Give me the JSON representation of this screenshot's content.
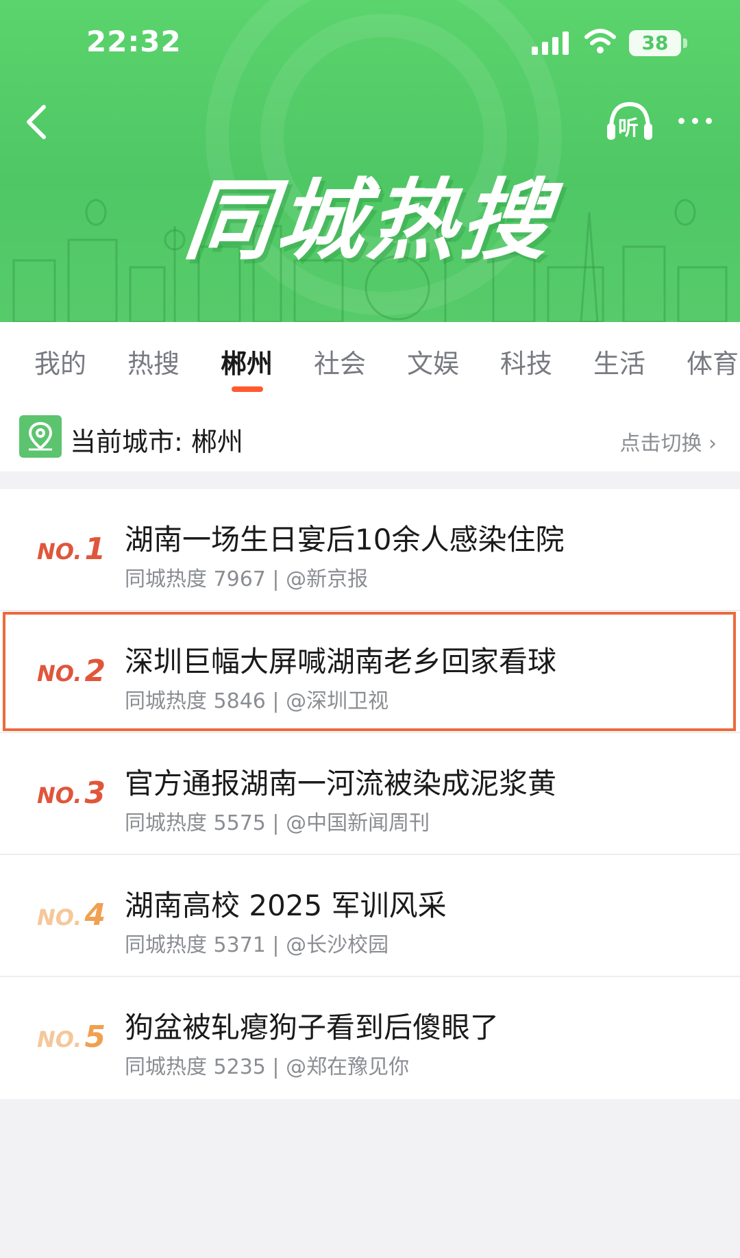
{
  "status_bar": {
    "time": "22:32",
    "battery": "38",
    "signal_icon": "signal-bars-icon",
    "wifi_icon": "wifi-icon"
  },
  "header": {
    "title": "同城热搜",
    "back_icon": "back-arrow-icon",
    "listen_label": "听",
    "more_icon": "more-dots-icon",
    "background_color": "#5bd46d"
  },
  "tabs": [
    {
      "label": "我的"
    },
    {
      "label": "热搜"
    },
    {
      "label": "郴州",
      "active": true
    },
    {
      "label": "社会"
    },
    {
      "label": "文娱"
    },
    {
      "label": "科技"
    },
    {
      "label": "生活"
    },
    {
      "label": "体育"
    }
  ],
  "city_bar": {
    "label": "当前城市: 郴州",
    "switch_label": "点击切换 ›"
  },
  "hot_list": [
    {
      "rank_prefix": "NO.",
      "rank": "1",
      "title": "湖南一场生日宴后10余人感染住院",
      "meta": "同城热度 7967 | @新京报",
      "rank_color": "#e0563a"
    },
    {
      "rank_prefix": "NO.",
      "rank": "2",
      "title": "深圳巨幅大屏喊湖南老乡回家看球",
      "meta": "同城热度 5846 | @深圳卫视",
      "rank_color": "#e0563a"
    },
    {
      "rank_prefix": "NO.",
      "rank": "3",
      "title": "官方通报湖南一河流被染成泥浆黄",
      "meta": "同城热度 5575 | @中国新闻周刊",
      "rank_color": "#e0563a"
    },
    {
      "rank_prefix": "NO.",
      "rank": "4",
      "title": "湖南高校 2025 军训风采",
      "meta": "同城热度 5371 | @长沙校园",
      "rank_color": "#f0a050"
    },
    {
      "rank_prefix": "NO.",
      "rank": "5",
      "title": "狗盆被轧瘪狗子看到后傻眼了",
      "meta": "同城热度 5235 | @郑在豫见你",
      "rank_color": "#f0a050"
    }
  ],
  "colors": {
    "accent": "#ff5a2e",
    "highlight_border": "#ec6a3c",
    "rank_top": "#e0563a",
    "rank_other": "#f0a050"
  }
}
